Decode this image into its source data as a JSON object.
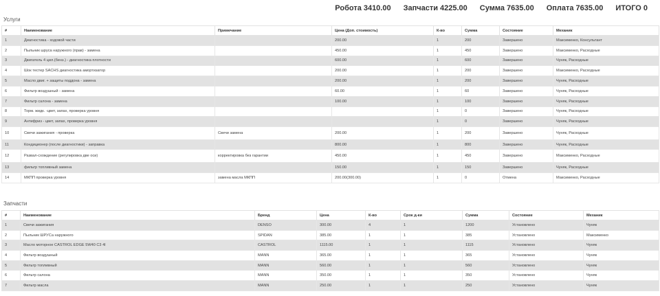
{
  "summary": [
    {
      "label": "Робота",
      "value": "3410.00"
    },
    {
      "label": "Запчасти",
      "value": "4225.00"
    },
    {
      "label": "Сумма",
      "value": "7635.00"
    },
    {
      "label": "Оплата",
      "value": "7635.00"
    },
    {
      "label": "ИТОГО",
      "value": "0"
    }
  ],
  "services": {
    "title": "Услуги",
    "columns": [
      "#",
      "Наименование",
      "Примечание",
      "Цена (Доп. стоимость)",
      "К-во",
      "Сумма",
      "Состояние",
      "Механик"
    ],
    "rows": [
      [
        "1",
        "Диагностика - ходовой части",
        "",
        "200.00",
        "1",
        "200",
        "Завершено",
        "Максименко, Консультант"
      ],
      [
        "2",
        "Пыльник шруса наружного (прав) - замена",
        "",
        "450.00",
        "1",
        "450",
        "Завершено",
        "Максименко, Расходные"
      ],
      [
        "3",
        "Двигатель 4 цил.(бенз.) - диагностика плотности",
        "",
        "600.00",
        "1",
        "600",
        "Завершено",
        "Чуняк, Расходные"
      ],
      [
        "4",
        "Шок тестер SACHS диагностика амортизатор",
        "",
        "200.00",
        "1",
        "200",
        "Завершено",
        "Максименко, Расходные"
      ],
      [
        "5",
        "Масло двиг. + защиты поддона - замена",
        "",
        "200.00",
        "1",
        "200",
        "Завершено",
        "Чуняк, Расходные"
      ],
      [
        "6",
        "Фильтр воздушный - замена",
        "",
        "60.00",
        "1",
        "60",
        "Завершено",
        "Чуняк, Расходные"
      ],
      [
        "7",
        "Фильтр салона - замена",
        "",
        "100.00",
        "1",
        "100",
        "Завершено",
        "Чуняк, Расходные"
      ],
      [
        "8",
        "Торм. жидк. -цвет, запах, проверка уровня",
        "",
        "",
        "1",
        "0",
        "Завершено",
        "Чуняк, Расходные"
      ],
      [
        "9",
        "Антифриз - цвет, запах, проверка уровня",
        "",
        "",
        "1",
        "0",
        "Завершено",
        "Чуняк, Расходные"
      ],
      [
        "10",
        "Свечи зажигания - проверка",
        "Свечи замена",
        "200.00",
        "1",
        "200",
        "Завершено",
        "Чуняк, Расходные"
      ],
      [
        "11",
        "Кондиционер (после диагностики) - заправка",
        "",
        "800.00",
        "1",
        "800",
        "Завершено",
        "Чуняк, Расходные"
      ],
      [
        "12",
        "Развал-схождение (регулировка две оси)",
        "корректировка без гарантии",
        "450.00",
        "1",
        "450",
        "Завершено",
        "Максименко, Расходные"
      ],
      [
        "13",
        "фильтр топливный замена",
        "",
        "150.00",
        "1",
        "150",
        "Завершено",
        "Чуняк, Расходные"
      ],
      [
        "14",
        "МКПП проверка уровня",
        "замена масла МКПП",
        "200.00(300.00)",
        "1",
        "0",
        "Отмена",
        "Максименко, Расходные"
      ]
    ]
  },
  "parts": {
    "title": "Запчасти",
    "columns": [
      "#",
      "Наименование",
      "Бренд",
      "Цена",
      "К-во",
      "Срок д-ки",
      "Сумма",
      "Состояние",
      "Механик"
    ],
    "rows": [
      [
        "1",
        "Свечи зажигания",
        "DENSO",
        "300.00",
        "4",
        "1",
        "1200",
        "Установлено",
        "Чуняк"
      ],
      [
        "2",
        "Пыльник ШРУСа наружного",
        "SPIDAN",
        "385.00",
        "1",
        "1",
        "385",
        "Установлено",
        "Максименко"
      ],
      [
        "3",
        "Масло моторное CASTROL EDGE 5W40 C3 4l",
        "CASTROL",
        "1115.00",
        "1",
        "1",
        "1115",
        "Установлено",
        "Чуняк"
      ],
      [
        "4",
        "Фильтр воздушный",
        "MANN",
        "365.00",
        "1",
        "1",
        "365",
        "Установлено",
        "Чуняк"
      ],
      [
        "5",
        "Фильтр топливный",
        "MANN",
        "560.00",
        "1",
        "1",
        "560",
        "Установлено",
        "Чуняк"
      ],
      [
        "6",
        "Фильтр салона",
        "MANN",
        "350.00",
        "1",
        "1",
        "350",
        "Установлено",
        "Чуняк"
      ],
      [
        "7",
        "Фильтр масла",
        "MANN",
        "250.00",
        "1",
        "1",
        "250",
        "Установлено",
        "Чуняк"
      ]
    ]
  }
}
